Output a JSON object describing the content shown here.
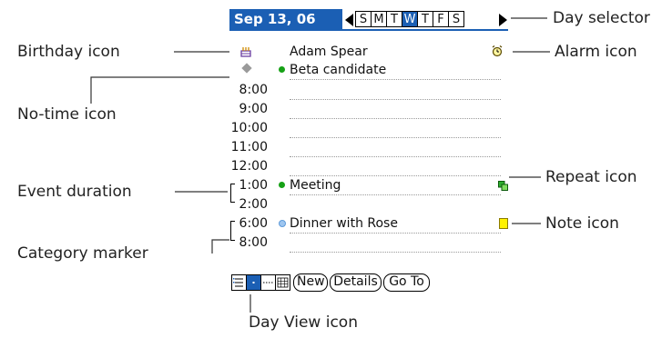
{
  "header": {
    "date": "Sep 13, 06",
    "weekdays": [
      "S",
      "M",
      "T",
      "W",
      "T",
      "F",
      "S"
    ],
    "selected_day_index": 3
  },
  "untimed": [
    {
      "icon": "birthday-icon",
      "text": "Adam Spear",
      "has_alarm": true
    },
    {
      "icon": "no-time-icon",
      "text": "Beta candidate",
      "category_color": "#16a116"
    }
  ],
  "times": [
    "8:00",
    "9:00",
    "10:00",
    "11:00",
    "12:00",
    "1:00",
    "2:00",
    "6:00",
    "8:00"
  ],
  "events": [
    {
      "time": "1:00",
      "text": "Meeting",
      "category_color": "#16a116",
      "has_repeat": true
    },
    {
      "time": "6:00",
      "text": "Dinner with Rose",
      "category_color": "#9ec6f0",
      "has_note": true
    }
  ],
  "toolbar": {
    "buttons": [
      "New",
      "Details",
      "Go To"
    ],
    "views": [
      "agenda-view",
      "day-view",
      "week-view",
      "month-view"
    ],
    "selected_view": "day-view"
  },
  "callouts": {
    "day_selector": "Day selector",
    "birthday_icon": "Birthday icon",
    "alarm_icon": "Alarm icon",
    "no_time_icon": "No-time icon",
    "repeat_icon": "Repeat icon",
    "event_duration": "Event duration",
    "note_icon": "Note icon",
    "category_marker": "Category marker",
    "day_view_icon": "Day View icon"
  },
  "colors": {
    "accent": "#1b5fb4",
    "green_category": "#16a116",
    "blue_category": "#9ec6f0",
    "note_yellow": "#fff200"
  }
}
